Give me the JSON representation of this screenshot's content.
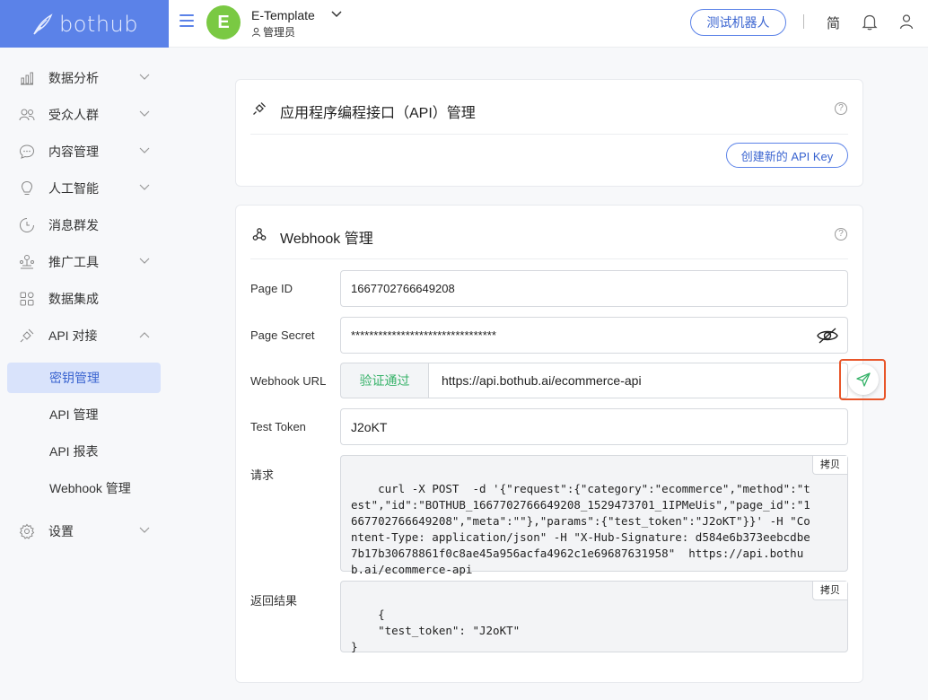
{
  "brand": {
    "name": "bothub"
  },
  "header": {
    "workspace_initial": "E",
    "workspace_name": "E-Template",
    "workspace_role": "管理员",
    "test_bot_label": "测试机器人",
    "language_label": "简"
  },
  "sidebar": {
    "items": [
      {
        "label": "数据分析",
        "icon": "chart-icon",
        "has_chevron": true
      },
      {
        "label": "受众人群",
        "icon": "users-icon",
        "has_chevron": true
      },
      {
        "label": "内容管理",
        "icon": "chat-icon",
        "has_chevron": true
      },
      {
        "label": "人工智能",
        "icon": "bulb-icon",
        "has_chevron": true
      },
      {
        "label": "消息群发",
        "icon": "broadcast-icon",
        "has_chevron": false
      },
      {
        "label": "推广工具",
        "icon": "tools-icon",
        "has_chevron": true
      },
      {
        "label": "数据集成",
        "icon": "grid-icon",
        "has_chevron": false
      },
      {
        "label": "API 对接",
        "icon": "plug-icon",
        "has_chevron": true,
        "expanded": true
      }
    ],
    "sub_items": [
      {
        "label": "密钥管理",
        "active": true
      },
      {
        "label": "API 管理",
        "active": false
      },
      {
        "label": "API 报表",
        "active": false
      },
      {
        "label": "Webhook 管理",
        "active": false
      }
    ],
    "settings_label": "设置"
  },
  "api_card": {
    "title": "应用程序编程接口（API）管理",
    "create_button": "创建新的 API Key",
    "help": "?"
  },
  "webhook_card": {
    "title": "Webhook 管理",
    "help": "?",
    "page_id_label": "Page ID",
    "page_id_value": "1667702766649208",
    "page_secret_label": "Page Secret",
    "page_secret_value": "********************************",
    "webhook_url_label": "Webhook URL",
    "verify_status": "验证通过",
    "webhook_url_value": "https://api.bothub.ai/ecommerce-api",
    "test_token_label": "Test Token",
    "test_token_value": "J2oKT",
    "request_label": "请求",
    "request_code": "curl -X POST  -d '{\"request\":{\"category\":\"ecommerce\",\"method\":\"test\",\"id\":\"BOTHUB_1667702766649208_1529473701_1IPMeUis\",\"page_id\":\"1667702766649208\",\"meta\":\"\"},\"params\":{\"test_token\":\"J2oKT\"}}' -H \"Content-Type: application/json\" -H \"X-Hub-Signature: d584e6b373eebcdbe7b17b30678861f0c8ae45a956acfa4962c1e69687631958\"  https://api.bothub.ai/ecommerce-api",
    "response_label": "返回结果",
    "response_code": "{\n    \"test_token\": \"J2oKT\"\n}",
    "copy_label": "拷贝"
  },
  "colors": {
    "brand": "#5b82e8",
    "success": "#38b36a",
    "highlight": "#e8562a"
  }
}
